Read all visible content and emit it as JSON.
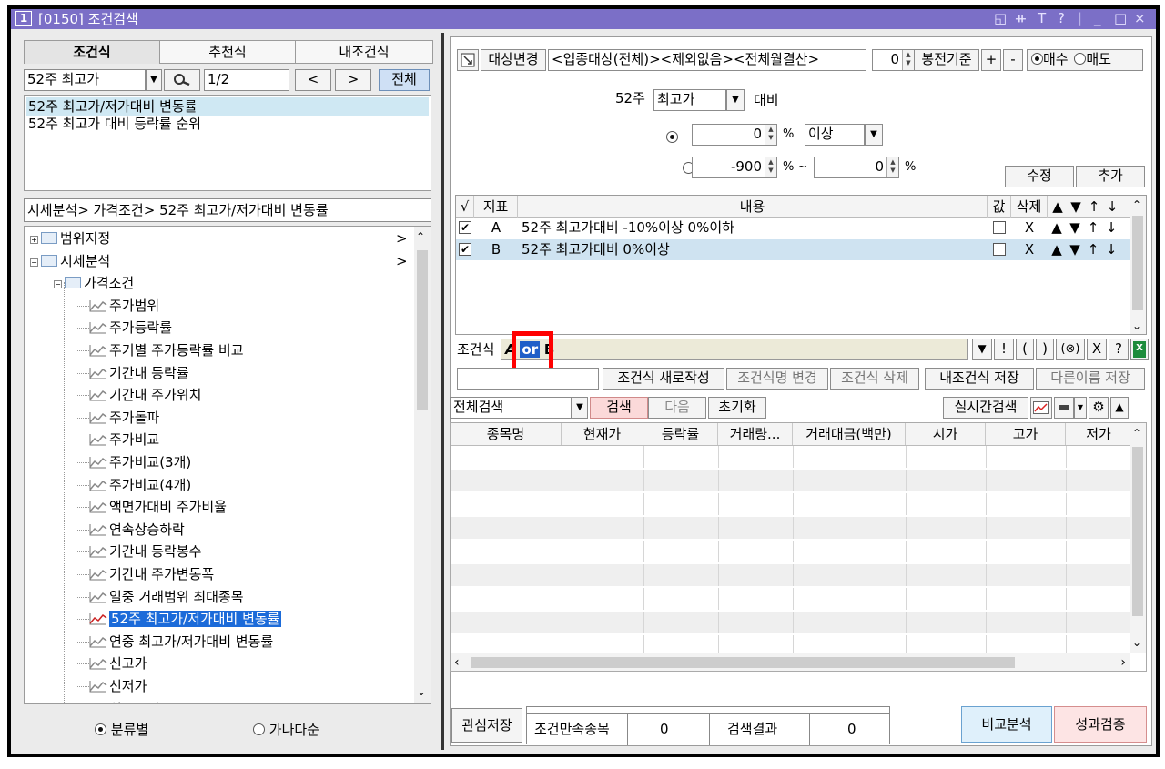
{
  "window": {
    "number": "1",
    "title": "[0150] 조건검색",
    "icons": [
      "layout-icon",
      "pin-icon",
      "font-icon",
      "help-icon",
      "minimize-icon",
      "maximize-icon",
      "close-icon"
    ],
    "icon_glyphs": [
      "◱",
      "ᚑ",
      "T",
      "?",
      "_",
      "□",
      "×"
    ]
  },
  "left": {
    "tabs": [
      "조건식",
      "추천식",
      "내조건식"
    ],
    "active_tab": 0,
    "category_select": "52주 최고가",
    "page_indicator": "1/2",
    "prev_label": "<",
    "next_label": ">",
    "all_label": "전체",
    "search_results": [
      "52주 최고가/저가대비 변동률",
      "52주 최고가 대비 등락률 순위"
    ],
    "breadcrumb": "시세분석> 가격조건> 52주 최고가/저가대비 변동률",
    "tree": [
      {
        "level": 0,
        "type": "folder",
        "label": "범위지정",
        "expander": "+",
        "arrow": ">"
      },
      {
        "level": 0,
        "type": "folder",
        "label": "시세분석",
        "expander": "−",
        "arrow": ">"
      },
      {
        "level": 1,
        "type": "folder",
        "label": "가격조건",
        "expander": "−"
      },
      {
        "level": 2,
        "type": "item",
        "label": "주가범위"
      },
      {
        "level": 2,
        "type": "item",
        "label": "주가등락률"
      },
      {
        "level": 2,
        "type": "item",
        "label": "주기별 주가등락률 비교"
      },
      {
        "level": 2,
        "type": "item",
        "label": "기간내 등락률"
      },
      {
        "level": 2,
        "type": "item",
        "label": "기간내 주가위치"
      },
      {
        "level": 2,
        "type": "item",
        "label": "주가돌파"
      },
      {
        "level": 2,
        "type": "item",
        "label": "주가비교"
      },
      {
        "level": 2,
        "type": "item",
        "label": "주가비교(3개)"
      },
      {
        "level": 2,
        "type": "item",
        "label": "주가비교(4개)"
      },
      {
        "level": 2,
        "type": "item",
        "label": "액면가대비 주가비율"
      },
      {
        "level": 2,
        "type": "item",
        "label": "연속상승하락"
      },
      {
        "level": 2,
        "type": "item",
        "label": "기간내 등락봉수"
      },
      {
        "level": 2,
        "type": "item",
        "label": "기간내 주가변동폭"
      },
      {
        "level": 2,
        "type": "item",
        "label": "일중 거래범위 최대종목"
      },
      {
        "level": 2,
        "type": "item",
        "label": "52주 최고가/저가대비 변동률",
        "selected": true
      },
      {
        "level": 2,
        "type": "item",
        "label": "연중 최고가/저가대비 변동률"
      },
      {
        "level": 2,
        "type": "item",
        "label": "신고가"
      },
      {
        "level": 2,
        "type": "item",
        "label": "신저가"
      },
      {
        "level": 2,
        "type": "item",
        "label": "최근조건"
      }
    ],
    "sort_options": [
      "분류별",
      "가나다순"
    ],
    "sort_selected": 0
  },
  "right": {
    "target_change_label": "대상변경",
    "target_text": "<업종대상(전체)><제외없음><전체월결산>",
    "bar_value": "0",
    "bar_basis_label": "봉전기준",
    "plus_label": "+",
    "minus_label": "-",
    "trade_options": [
      "매수",
      "매도"
    ],
    "trade_selected": 0,
    "condition": {
      "period_label": "52주",
      "price_type": "최고가",
      "compare_label": "대비",
      "option1_value": "0",
      "option1_unit": "%",
      "option1_op": "이상",
      "option2_from": "-900",
      "option2_unit_from": "% ~",
      "option2_to": "0",
      "option2_unit_to": "%",
      "selected_option": 0,
      "edit_label": "수정",
      "add_label": "추가"
    },
    "indicator_table": {
      "headers": [
        "√",
        "지표",
        "내용",
        "값",
        "삭제",
        "▲",
        "▼",
        "↑",
        "↓"
      ],
      "rows": [
        {
          "checked": true,
          "id": "A",
          "content": "52주 최고가대비 -10%이상 0%이하",
          "value_checked": false,
          "delete": "X"
        },
        {
          "checked": true,
          "id": "B",
          "content": "52주 최고가대비 0%이상",
          "value_checked": false,
          "delete": "X"
        }
      ]
    },
    "formula": {
      "label": "조건식",
      "prefix": "A",
      "operator": "or",
      "suffix": "B",
      "tools": [
        "▼",
        "!",
        "(",
        ")",
        "(⊗)",
        "X",
        "?"
      ]
    },
    "formula_actions": {
      "name_placeholder": "",
      "new_label": "조건식 새로작성",
      "rename_label": "조건식명 변경",
      "delete_label": "조건식 삭제",
      "save_label": "내조건식 저장",
      "save_as_label": "다른이름 저장"
    },
    "search_bar": {
      "scope": "전체검색",
      "search_label": "검색",
      "next_label": "다음",
      "reset_label": "초기화",
      "realtime_label": "실시간검색"
    },
    "results_table": {
      "headers": [
        "종목명",
        "현재가",
        "등락률",
        "거래량...",
        "거래대금(백만)",
        "시가",
        "고가",
        "저가"
      ],
      "rows": []
    },
    "footer": {
      "watch_save_label": "관심저장",
      "satisfied_label": "조건만족종목",
      "satisfied_value": "0",
      "result_label": "검색결과",
      "result_value": "0",
      "compare_label": "비교분석",
      "performance_label": "성과검증"
    },
    "highlight_color": "#ff0000"
  }
}
